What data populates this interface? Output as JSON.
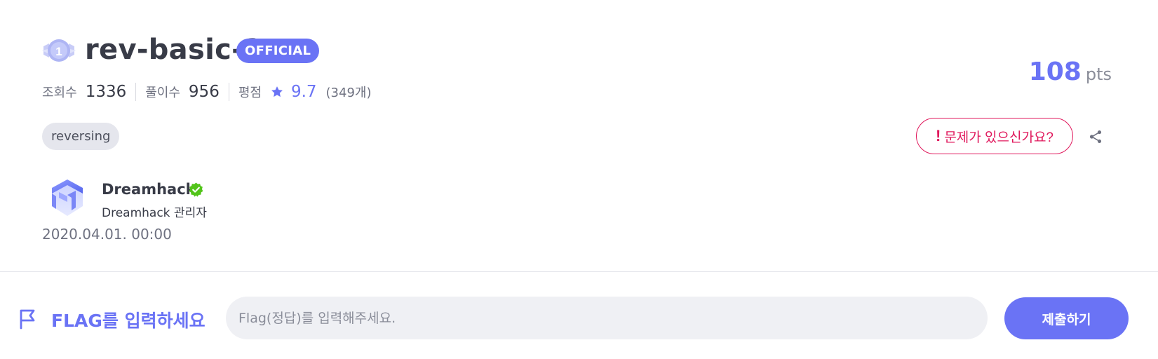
{
  "challenge": {
    "level": "1",
    "title": "rev-basic-2",
    "badge": "OFFICIAL",
    "stats": {
      "views_label": "조회수",
      "views": "1336",
      "solves_label": "풀이수",
      "solves": "956",
      "rating_label": "평점",
      "rating": "9.7",
      "rating_count": "(349개)"
    },
    "tag": "reversing",
    "points": {
      "value": "108",
      "unit": "pts"
    },
    "report_label": "문제가 있으신가요?",
    "report_bang": "!"
  },
  "author": {
    "name": "Dreamhack",
    "role": "Dreamhack 관리자",
    "date": "2020.04.01. 00:00"
  },
  "flag": {
    "label": "FLAG를 입력하세요",
    "placeholder": "Flag(정답)를 입력해주세요.",
    "value": "",
    "submit_label": "제출하기"
  },
  "colors": {
    "accent": "#6a73f5",
    "report": "#e0185c",
    "verified": "#52c41a",
    "tag_bg": "#e5e6ed",
    "input_bg": "#eff0f4"
  }
}
